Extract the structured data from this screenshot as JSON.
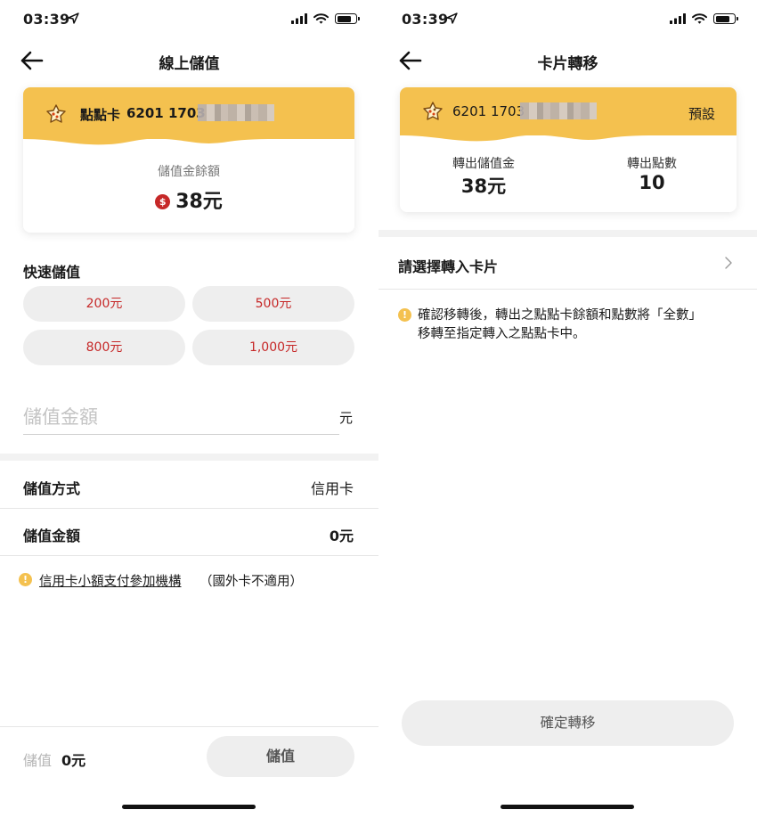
{
  "status": {
    "time": "03:39"
  },
  "left": {
    "title": "線上儲值",
    "card": {
      "label": "點點卡",
      "number_visible": "6201 1703"
    },
    "balance": {
      "label": "儲值金餘額",
      "coin_symbol": "$",
      "amount": "38元"
    },
    "quick_topup": {
      "title": "快速儲值",
      "options": [
        "200元",
        "500元",
        "800元",
        "1,000元"
      ]
    },
    "amount_input": {
      "placeholder": "儲值金額",
      "unit": "元"
    },
    "method": {
      "label": "儲值方式",
      "value": "信用卡"
    },
    "total": {
      "label": "儲值金額",
      "value": "0元"
    },
    "note": {
      "link": "信用卡小額支付參加機構",
      "suffix": "（國外卡不適用）"
    },
    "footer": {
      "sum_label": "儲值",
      "sum_value": "0元",
      "button": "儲值"
    }
  },
  "right": {
    "title": "卡片轉移",
    "card": {
      "number_visible": "6201 1703",
      "tag": "預設"
    },
    "stats": [
      {
        "label": "轉出儲值金",
        "value": "38元"
      },
      {
        "label": "轉出點數",
        "value": "10"
      }
    ],
    "select_label": "請選擇轉入卡片",
    "notice": "確認移轉後，轉出之點點卡餘額和點數將「全數」移轉至指定轉入之點點卡中。",
    "confirm_button": "確定轉移"
  },
  "colors": {
    "accent_yellow": "#f4c14f",
    "price_red": "#c62828",
    "button_gray": "#eeeeee"
  },
  "icons": [
    "location-arrow-icon",
    "signal-icon",
    "wifi-icon",
    "battery-icon",
    "back-arrow-icon",
    "card-logo-icon",
    "coin-icon",
    "info-icon",
    "chevron-right-icon"
  ],
  "battery_level": 0.75
}
